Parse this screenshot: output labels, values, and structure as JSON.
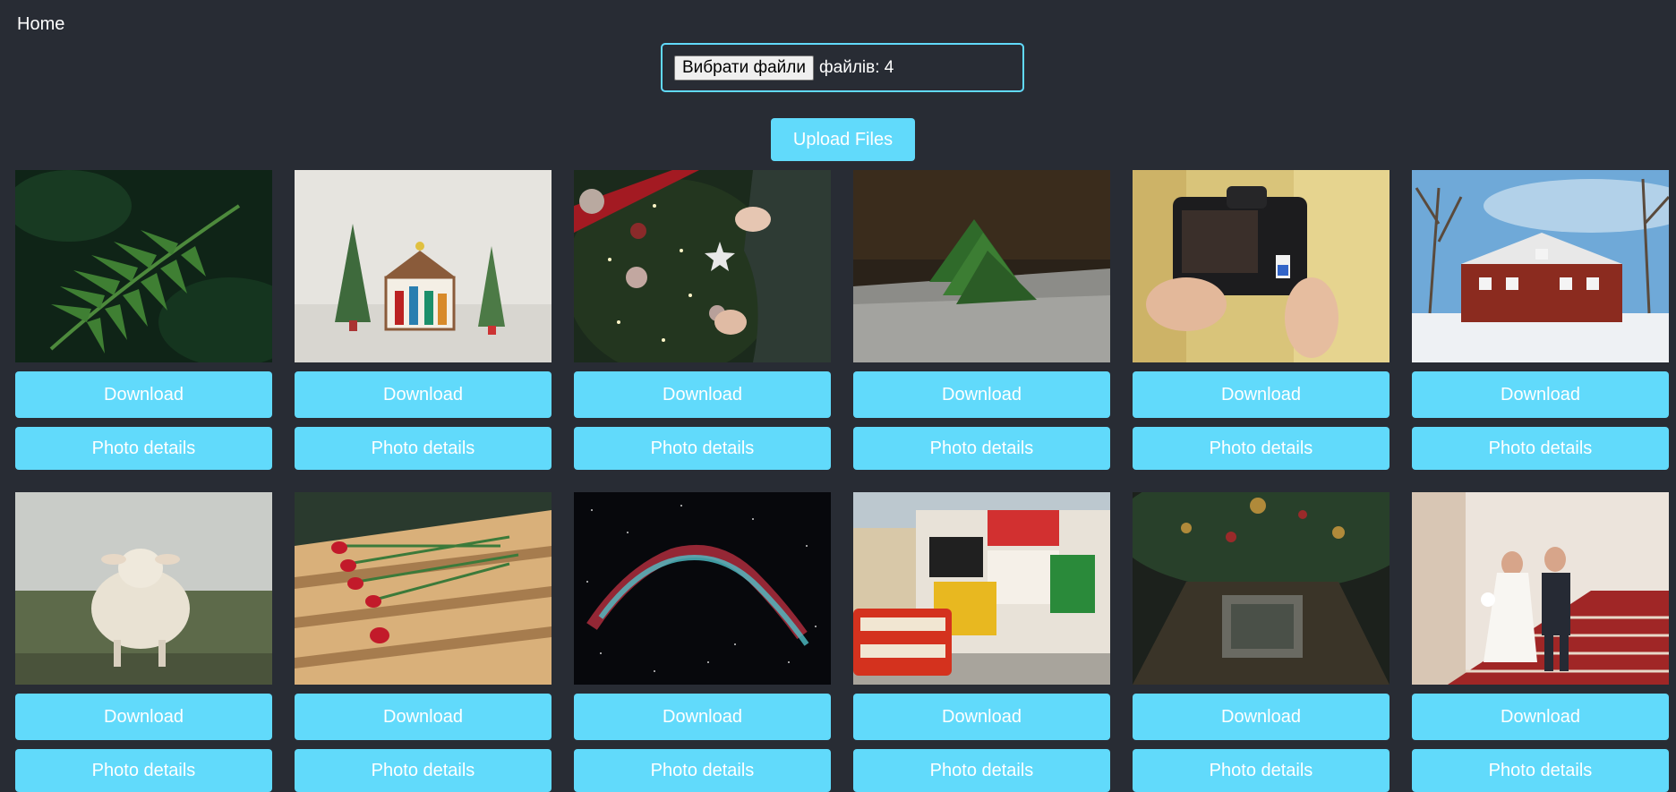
{
  "nav": {
    "home_label": "Home"
  },
  "upload": {
    "choose_label": "Вибрати файли",
    "file_count": "файлів: 4",
    "upload_label": "Upload Files"
  },
  "photos": [
    {
      "subject": "fern leaves",
      "download_label": "Download",
      "details_label": "Photo details"
    },
    {
      "subject": "nativity scene with small trees",
      "download_label": "Download",
      "details_label": "Photo details"
    },
    {
      "subject": "hanging ornaments on christmas tree",
      "download_label": "Download",
      "details_label": "Photo details"
    },
    {
      "subject": "paper christmas tree on knit fabric",
      "download_label": "Download",
      "details_label": "Photo details"
    },
    {
      "subject": "hands inserting sd card in camera",
      "download_label": "Download",
      "details_label": "Photo details"
    },
    {
      "subject": "red house in snow",
      "download_label": "Download",
      "details_label": "Photo details"
    },
    {
      "subject": "sheep standing in field",
      "download_label": "Download",
      "details_label": "Photo details"
    },
    {
      "subject": "red roses on wooden bench",
      "download_label": "Download",
      "details_label": "Photo details"
    },
    {
      "subject": "nebula in space",
      "download_label": "Download",
      "details_label": "Photo details"
    },
    {
      "subject": "piccadilly circus with red bus",
      "download_label": "Download",
      "details_label": "Photo details"
    },
    {
      "subject": "christmas tree viewed from below",
      "download_label": "Download",
      "details_label": "Photo details"
    },
    {
      "subject": "wedding couple walking down stairs",
      "download_label": "Download",
      "details_label": "Photo details"
    }
  ],
  "colors": {
    "background": "#282c34",
    "accent": "#61dafb"
  }
}
